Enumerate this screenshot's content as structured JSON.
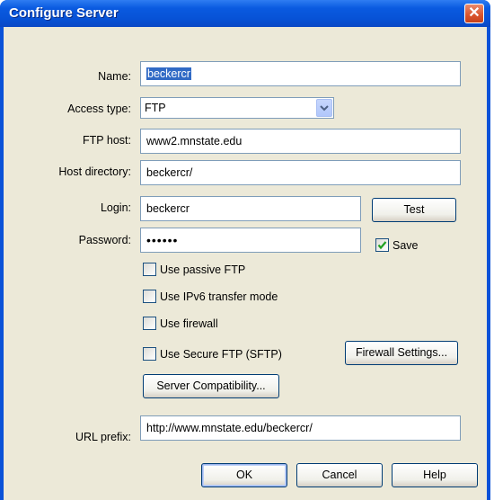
{
  "window": {
    "title": "Configure Server"
  },
  "form": {
    "name_label": "Name:",
    "name_value": "beckercr",
    "access_type_label": "Access type:",
    "access_type_value": "FTP",
    "ftp_host_label": "FTP host:",
    "ftp_host_value": "www2.mnstate.edu",
    "host_directory_label": "Host directory:",
    "host_directory_value": "beckercr/",
    "login_label": "Login:",
    "login_value": "beckercr",
    "password_label": "Password:",
    "password_value": "••••••",
    "test_button": "Test",
    "save_label": "Save",
    "save_checked": true,
    "passive_ftp_label": "Use passive FTP",
    "ipv6_label": "Use IPv6 transfer mode",
    "firewall_label": "Use firewall",
    "sftp_label": "Use Secure FTP (SFTP)",
    "firewall_settings_button": "Firewall Settings...",
    "server_compat_button": "Server Compatibility...",
    "url_prefix_label": "URL prefix:",
    "url_prefix_value": "http://www.mnstate.edu/beckercr/"
  },
  "buttons": {
    "ok": "OK",
    "cancel": "Cancel",
    "help": "Help"
  }
}
